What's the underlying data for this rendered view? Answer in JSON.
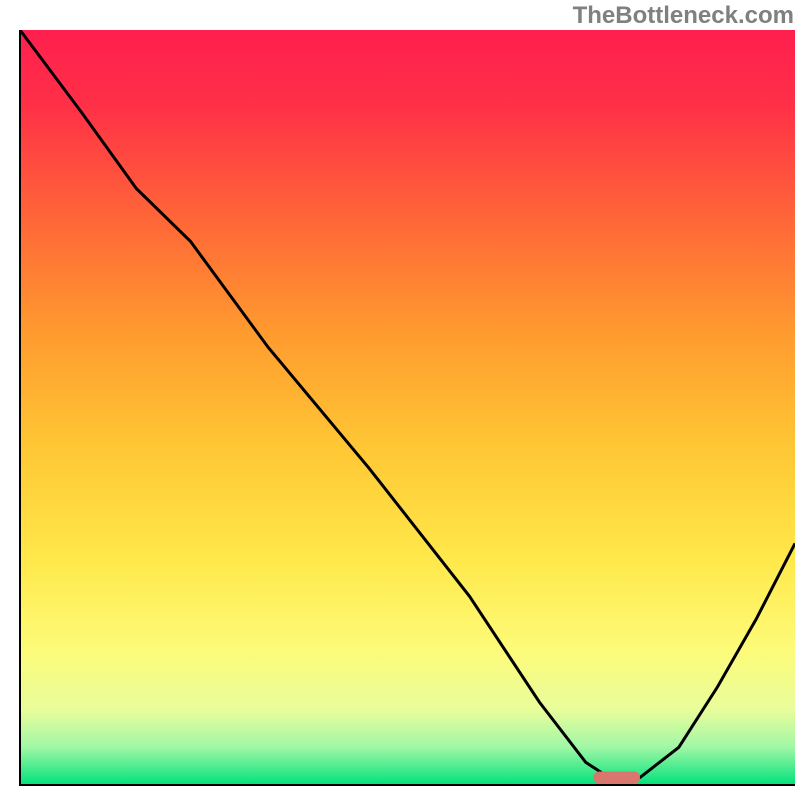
{
  "watermark": "TheBottleneck.com",
  "chart_data": {
    "type": "line",
    "title": "",
    "xlabel": "",
    "ylabel": "",
    "xlim": [
      0,
      100
    ],
    "ylim": [
      0,
      100
    ],
    "grid": false,
    "legend_position": "none",
    "background_gradient": {
      "stops": [
        {
          "offset": 0.0,
          "color": "#ff1f4e"
        },
        {
          "offset": 0.1,
          "color": "#ff3047"
        },
        {
          "offset": 0.25,
          "color": "#ff6638"
        },
        {
          "offset": 0.4,
          "color": "#ff9a2f"
        },
        {
          "offset": 0.55,
          "color": "#ffc634"
        },
        {
          "offset": 0.7,
          "color": "#ffe84a"
        },
        {
          "offset": 0.82,
          "color": "#fdfb78"
        },
        {
          "offset": 0.9,
          "color": "#e9fd9b"
        },
        {
          "offset": 0.95,
          "color": "#a0f7a6"
        },
        {
          "offset": 1.0,
          "color": "#00e27a"
        }
      ]
    },
    "series": [
      {
        "name": "bottleneck-curve",
        "x": [
          0,
          8,
          15,
          22,
          32,
          45,
          58,
          67,
          73,
          76,
          80,
          85,
          90,
          95,
          100
        ],
        "values": [
          100,
          89,
          79,
          72,
          58,
          42,
          25,
          11,
          3,
          1,
          1,
          5,
          13,
          22,
          32
        ]
      }
    ],
    "marker": {
      "name": "optimal-range",
      "x_start": 74,
      "x_end": 80,
      "y": 1,
      "color": "#d9766e"
    }
  }
}
